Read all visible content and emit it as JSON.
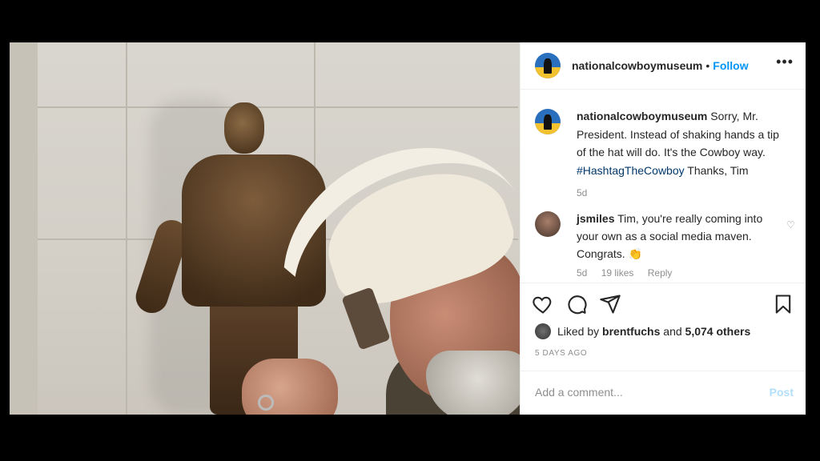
{
  "post": {
    "username": "nationalcowboymuseum",
    "separator": "•",
    "follow_label": "Follow",
    "more_label": "•••"
  },
  "caption": {
    "username": "nationalcowboymuseum",
    "text": "Sorry, Mr. President. Instead of shaking hands a tip of the hat will do. It's the Cowboy way.",
    "hashtag": "#HashtagTheCowboy",
    "trailing": "Thanks, Tim",
    "time": "5d"
  },
  "comment": {
    "username": "jsmiles",
    "text": "Tim, you're really coming into your own as a social media maven. Congrats. 👏",
    "time": "5d",
    "likes": "19 likes",
    "reply": "Reply"
  },
  "likes": {
    "prefix": "Liked by",
    "user": "brentfuchs",
    "middle": "and",
    "count": "5,074 others"
  },
  "timestamp": "5 DAYS AGO",
  "add_comment": {
    "placeholder": "Add a comment...",
    "post_label": "Post"
  },
  "colors": {
    "link": "#0095f6",
    "hashtag": "#00376b",
    "muted": "#8e8e8e",
    "post_disabled": "#b2dffc"
  }
}
